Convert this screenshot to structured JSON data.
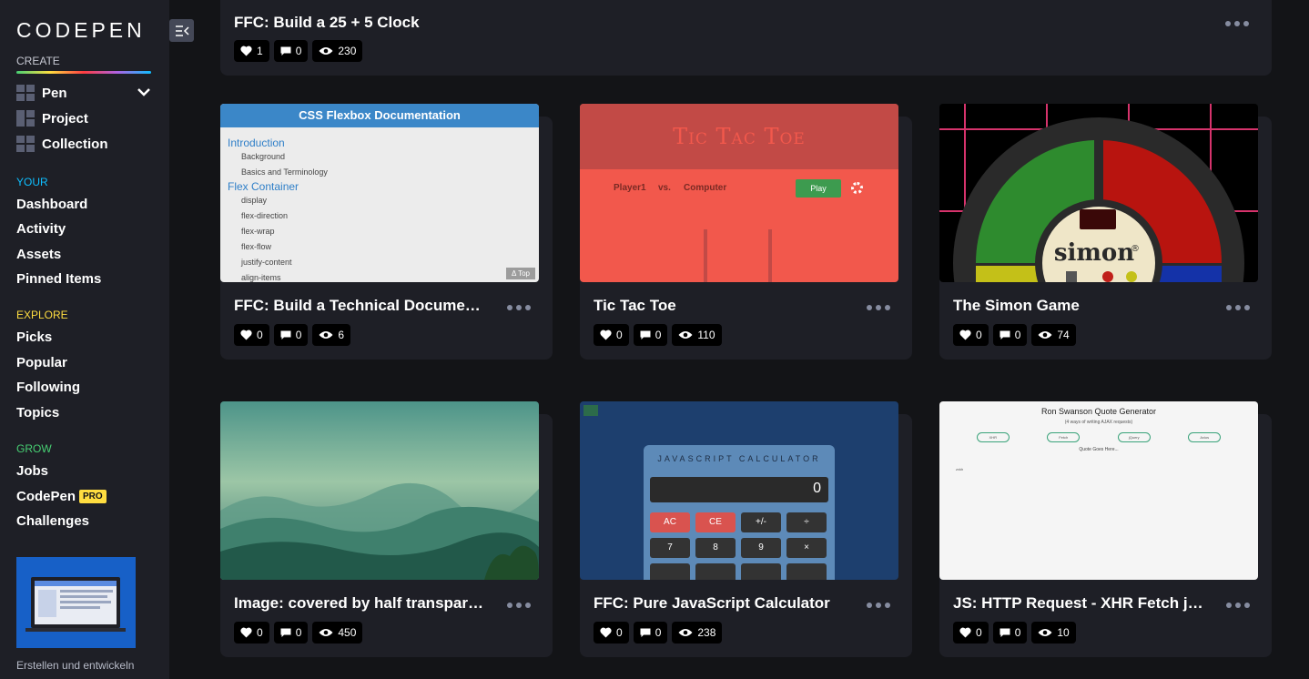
{
  "brand": {
    "logo_text": "CODEPEN"
  },
  "create": {
    "label": "CREATE",
    "items": [
      {
        "label": "Pen",
        "icon": "pen-icon"
      },
      {
        "label": "Project",
        "icon": "project-icon"
      },
      {
        "label": "Collection",
        "icon": "collection-icon"
      }
    ]
  },
  "your": {
    "label": "YOUR",
    "items": [
      "Dashboard",
      "Activity",
      "Assets",
      "Pinned Items"
    ]
  },
  "explore": {
    "label": "EXPLORE",
    "items": [
      "Picks",
      "Popular",
      "Following",
      "Topics"
    ]
  },
  "grow": {
    "label": "GROW",
    "items": [
      "Jobs",
      "CodePen",
      "Challenges"
    ],
    "pro_badge": "PRO"
  },
  "promo": {
    "text": "Erstellen und entwickeln"
  },
  "colors": {
    "your": "#0ebeff",
    "explore": "#ffdd40",
    "grow": "#47cf73",
    "sidebar": "#1e1f26",
    "background": "#131417"
  },
  "top_card": {
    "title": "FFC: Build a 25 + 5 Clock",
    "likes": "1",
    "comments": "0",
    "views": "230"
  },
  "cards": [
    {
      "title": "FFC: Build a Technical Documentation Page",
      "likes": "0",
      "comments": "0",
      "views": "6",
      "thumb": {
        "heading": "CSS Flexbox Documentation",
        "sections": [
          {
            "title": "Introduction",
            "links": [
              "Background",
              "Basics and Terminology"
            ]
          },
          {
            "title": "Flex Container",
            "links": [
              "display",
              "flex-direction",
              "flex-wrap",
              "flex-flow",
              "justify-content",
              "align-items"
            ]
          }
        ],
        "top_button": "Δ Top"
      }
    },
    {
      "title": "Tic Tac Toe",
      "likes": "0",
      "comments": "0",
      "views": "110",
      "thumb": {
        "heading": "Tic Tac Toe",
        "player": "Player1",
        "vs": "vs.",
        "opponent": "Computer",
        "play": "Play"
      }
    },
    {
      "title": "The Simon Game",
      "likes": "0",
      "comments": "0",
      "views": "74",
      "thumb": {
        "brand": "simon",
        "mark": "®"
      }
    },
    {
      "title": "Image: covered by half transparent overlay",
      "likes": "0",
      "comments": "0",
      "views": "450",
      "thumb": {}
    },
    {
      "title": "FFC: Pure JavaScript Calculator",
      "likes": "0",
      "comments": "0",
      "views": "238",
      "thumb": {
        "heading": "JAVASCRIPT CALCULATOR",
        "display": "0",
        "keys": [
          "AC",
          "CE",
          "+/-",
          "÷",
          "7",
          "8",
          "9",
          "×"
        ]
      }
    },
    {
      "title": "JS: HTTP Request - XHR Fetch jQuery Axios",
      "likes": "0",
      "comments": "0",
      "views": "10",
      "thumb": {
        "heading": "Ron Swanson Quote Generator",
        "subheading": "(4 ways of writing AJAX requests)",
        "buttons": [
          "XHR",
          "Fetch",
          "jQuery",
          "Axios"
        ],
        "quote": "Quote Goes Here...",
        "footnote": "zxkh"
      }
    }
  ]
}
